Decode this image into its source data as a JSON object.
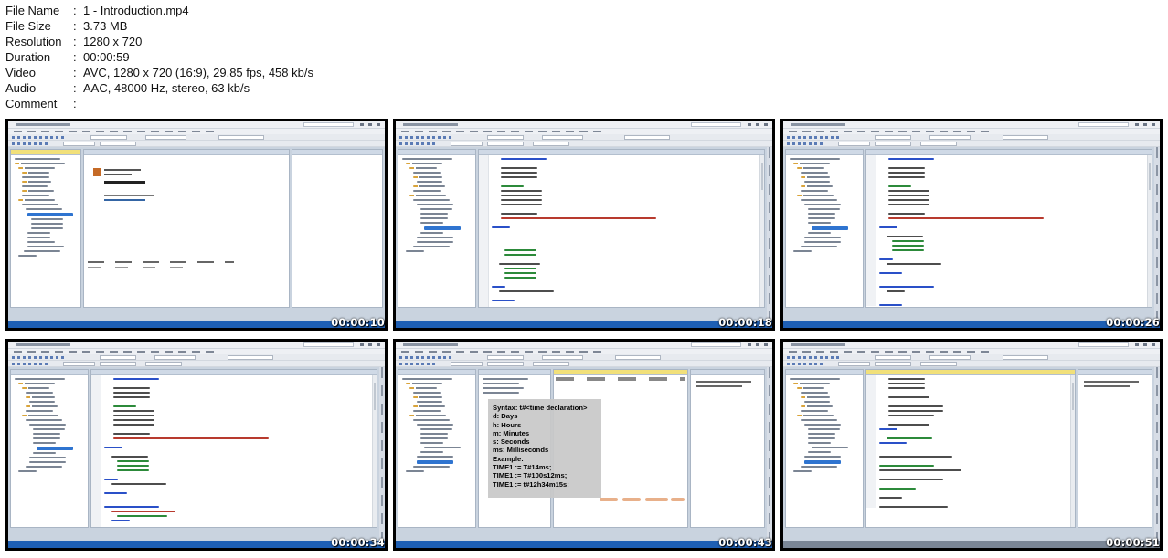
{
  "file_info": [
    {
      "key": "File Name",
      "value": "1 - Introduction.mp4"
    },
    {
      "key": "File Size",
      "value": "3.73 MB"
    },
    {
      "key": "Resolution",
      "value": "1280 x 720"
    },
    {
      "key": "Duration",
      "value": "00:00:59"
    },
    {
      "key": "Video",
      "value": "AVC, 1280 x 720 (16:9), 29.85 fps, 458 kb/s"
    },
    {
      "key": "Audio",
      "value": "AAC, 48000 Hz, stereo, 63 kb/s"
    },
    {
      "key": "Comment",
      "value": ""
    }
  ],
  "separator": ":",
  "thumbnails": [
    {
      "timestamp": "00:00:10"
    },
    {
      "timestamp": "00:00:18"
    },
    {
      "timestamp": "00:00:26"
    },
    {
      "timestamp": "00:00:34"
    },
    {
      "timestamp": "00:00:43"
    },
    {
      "timestamp": "00:00:51"
    }
  ],
  "overlay": {
    "lines": [
      "Syntax: t#<time declaration>",
      "d: Days",
      "h: Hours",
      "m: Minutes",
      "s: Seconds",
      "ms: Milliseconds",
      "Example:",
      "TIME1 := T#14ms;",
      "TIME1 := T#100s12ms;",
      "TIME1 := t#12h34m15s;"
    ]
  },
  "colors": {
    "status_blue": "#1e5fb4",
    "tab_active": "#f1e07a",
    "tree_selected": "#2f74d0"
  }
}
